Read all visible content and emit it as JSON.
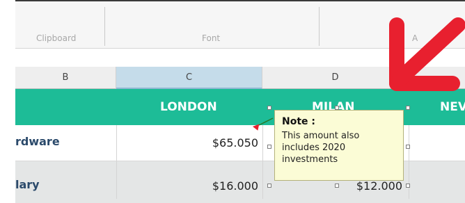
{
  "ribbon": {
    "groups": [
      "Clipboard",
      "Font",
      "A"
    ]
  },
  "columns": [
    "B",
    "C",
    "D"
  ],
  "header_cities": [
    "LONDON",
    "MILAN",
    "NEV"
  ],
  "rows": [
    {
      "label": "rdware",
      "london": "$65.050",
      "milan": ""
    },
    {
      "label": "lary",
      "london": "$16.000",
      "milan": "$12.000"
    }
  ],
  "note": {
    "title": "Note :",
    "body": "This amount also includes 2020 investments"
  },
  "colors": {
    "header_teal": "#1dbc97",
    "note_bg": "#fbfcd6",
    "arrow_red": "#e8202f"
  },
  "icons": [
    "comment-indicator-icon",
    "red-arrow-icon"
  ]
}
